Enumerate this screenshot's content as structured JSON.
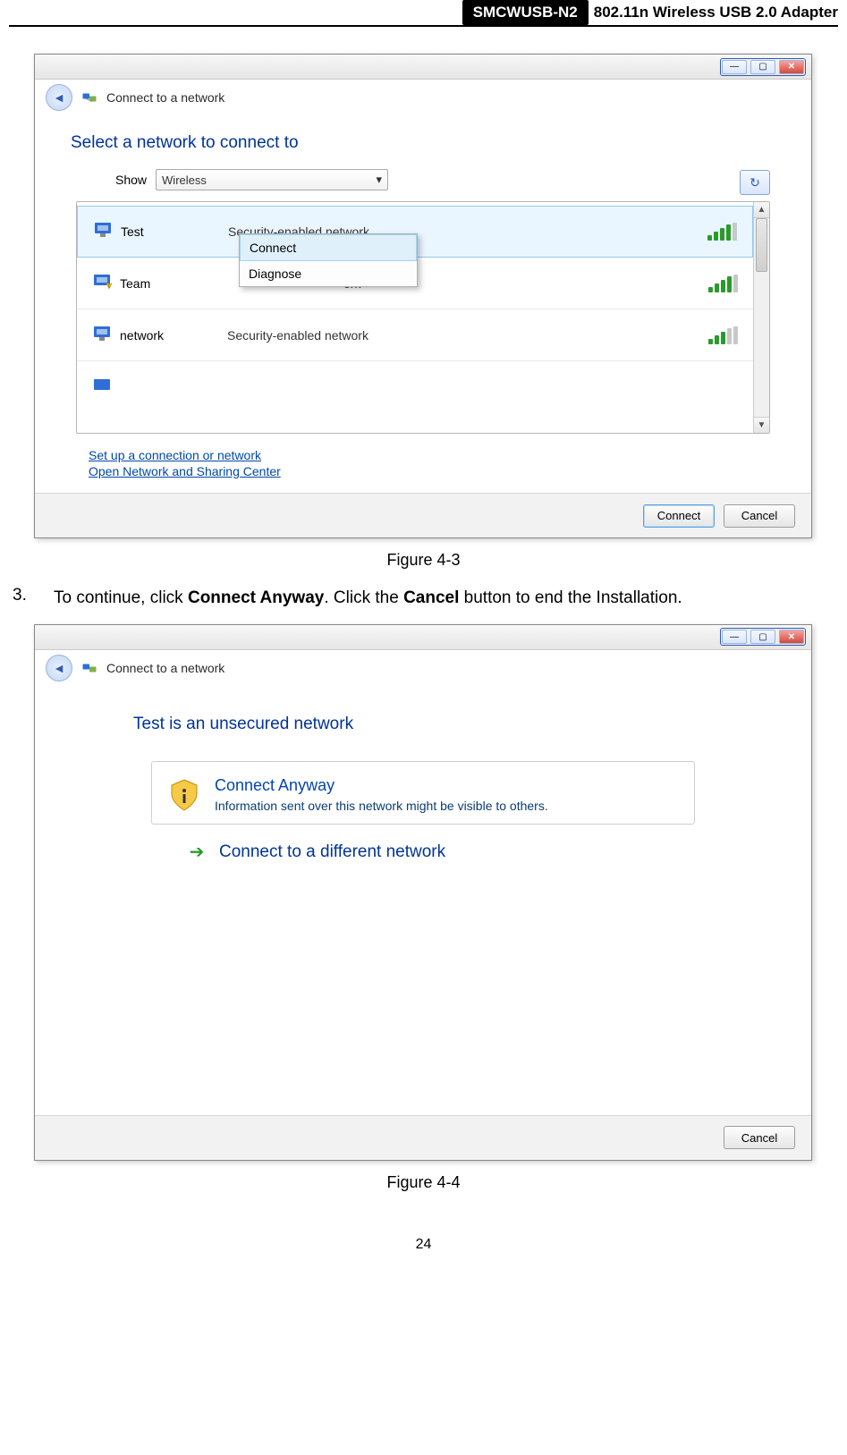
{
  "header": {
    "product": "SMCWUSB-N2",
    "title": "802.11n Wireless USB 2.0 Adapter"
  },
  "figure1": {
    "address_bar": "Connect to a network",
    "panel_title": "Select a network to connect to",
    "show_label": "Show",
    "show_value": "Wireless",
    "networks": [
      {
        "name": "Test",
        "status": "Security-enabled network",
        "selected": true,
        "bars": 4
      },
      {
        "name": "Team",
        "status": "ork",
        "selected": false,
        "bars": 4
      },
      {
        "name": "network",
        "status": "Security-enabled network",
        "selected": false,
        "bars": 3
      }
    ],
    "context_menu": {
      "items": [
        "Connect",
        "Diagnose"
      ],
      "selected_index": 0
    },
    "link1": "Set up a connection or network",
    "link2": "Open Network and Sharing Center",
    "connect_btn": "Connect",
    "cancel_btn": "Cancel",
    "caption": "Figure 4-3"
  },
  "step3": {
    "num": "3.",
    "pre": "To continue, click ",
    "bold1": "Connect Anyway",
    "mid": ". Click the ",
    "bold2": "Cancel",
    "post": " button to end the Installation."
  },
  "figure2": {
    "address_bar": "Connect to a network",
    "title_network": "Test  is an unsecured network",
    "anyway_title": "Connect Anyway",
    "anyway_sub": "Information sent over this network might be visible to others.",
    "diff_label": "Connect to a different network",
    "cancel_btn": "Cancel",
    "caption": "Figure 4-4"
  },
  "page_number": "24"
}
